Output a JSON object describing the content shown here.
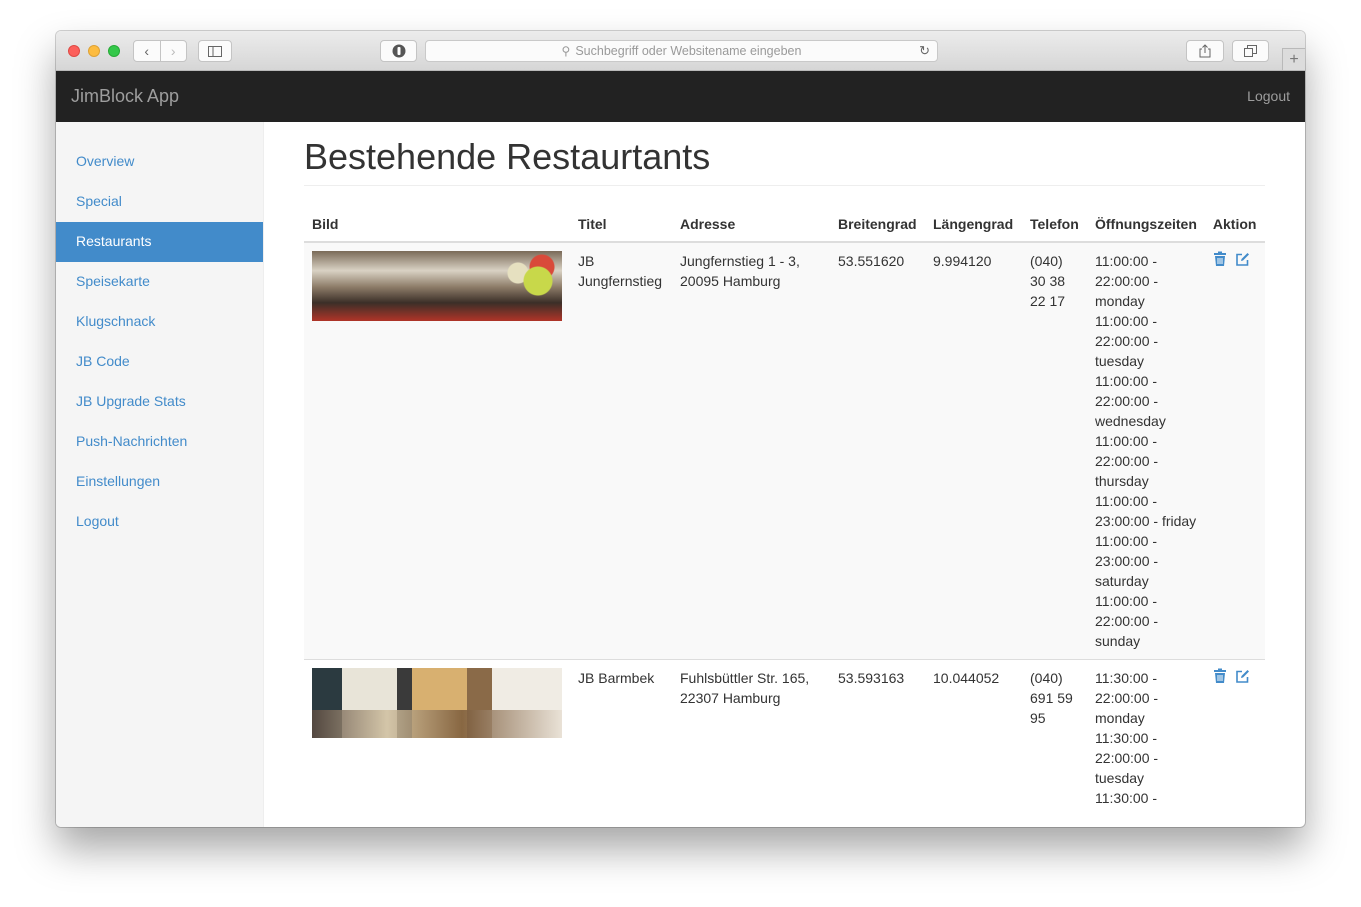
{
  "browser": {
    "address_placeholder": "Suchbegriff oder Websitename eingeben"
  },
  "navbar": {
    "brand": "JimBlock App",
    "logout": "Logout"
  },
  "sidebar": {
    "items": [
      {
        "label": "Overview"
      },
      {
        "label": "Special"
      },
      {
        "label": "Restaurants"
      },
      {
        "label": "Speisekarte"
      },
      {
        "label": "Klugschnack"
      },
      {
        "label": "JB Code"
      },
      {
        "label": "JB Upgrade Stats"
      },
      {
        "label": "Push-Nachrichten"
      },
      {
        "label": "Einstellungen"
      },
      {
        "label": "Logout"
      }
    ],
    "active_index": 2
  },
  "main": {
    "title": "Bestehende Restaurtants",
    "columns": [
      "Bild",
      "Titel",
      "Adresse",
      "Breitengrad",
      "Längengrad",
      "Telefon",
      "Öffnungszeiten",
      "Aktion"
    ],
    "rows": [
      {
        "titel": "JB Jungfernstieg",
        "adresse": "Jungfernstieg 1 - 3, 20095 Hamburg",
        "breitengrad": "53.551620",
        "laengengrad": "9.994120",
        "telefon": "(040) 30 38 22 17",
        "oeffnungszeiten": [
          "11:00:00 - 22:00:00 - monday",
          "11:00:00 - 22:00:00 - tuesday",
          "11:00:00 - 22:00:00 - wednesday",
          "11:00:00 - 22:00:00 - thursday",
          "11:00:00 - 23:00:00 - friday",
          "11:00:00 - 23:00:00 - saturday",
          "11:00:00 - 22:00:00 - sunday"
        ]
      },
      {
        "titel": "JB Barmbek",
        "adresse": "Fuhlsbüttler Str. 165, 22307 Hamburg",
        "breitengrad": "53.593163",
        "laengengrad": "10.044052",
        "telefon": "(040) 691 59 95",
        "oeffnungszeiten": [
          "11:30:00 - 22:00:00 - monday",
          "11:30:00 - 22:00:00 - tuesday",
          "11:30:00 -"
        ]
      }
    ]
  },
  "icons": {
    "delete": "trash-icon",
    "edit": "edit-icon"
  },
  "colors": {
    "navbar_bg": "#222222",
    "link": "#428bca",
    "active_bg": "#428bca"
  }
}
